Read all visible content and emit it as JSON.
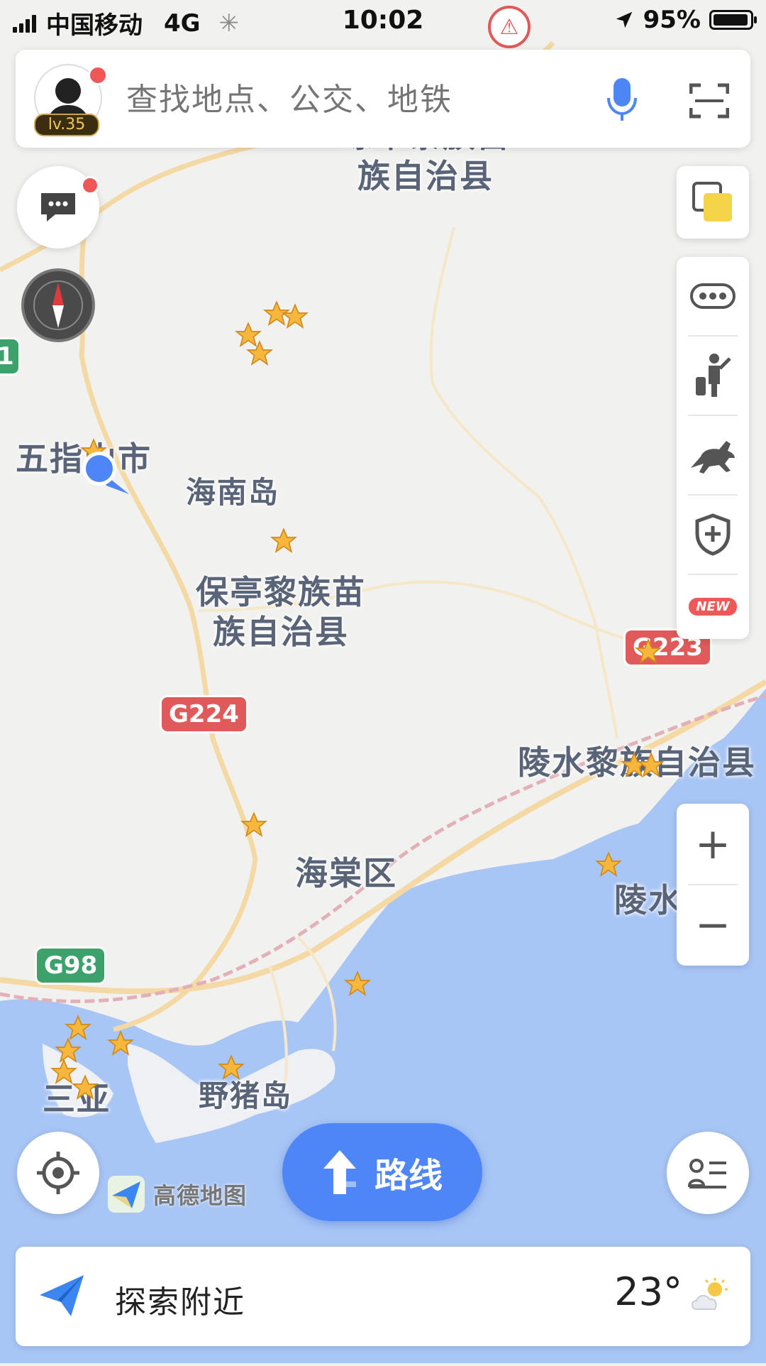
{
  "status_bar": {
    "carrier": "中国移动",
    "network": "4G",
    "time": "10:02",
    "battery": "95%",
    "battery_level": 0.95
  },
  "search": {
    "placeholder": "查找地点、公交、地铁",
    "level": "lv.35",
    "mic_icon": "microphone-icon",
    "scan_icon": "scan-icon"
  },
  "map": {
    "labels": {
      "qiongzhong_top": "琼中黎族苗",
      "qiongzhong_bottom": "族自治县",
      "wuzhishan": "五指山市",
      "hainan_island": "海南岛",
      "baoting_top": "保亭黎族苗",
      "baoting_bottom": "族自治县",
      "lingshui_county": "陵水黎族自治县",
      "haitang": "海棠区",
      "lingshui": "陵水",
      "sanya": "三亚",
      "yezhu_island": "野猪岛"
    },
    "road_shields": {
      "g224": "G224",
      "g223": "G223",
      "g98": "G98",
      "left_edge": "1"
    },
    "colors": {
      "land": "#f1f1ef",
      "sea": "#a7c5f5",
      "road": "#f4d9a4",
      "rail": "#e2b0b6",
      "accent": "#4f86f7"
    }
  },
  "tools": {
    "layers_icon": "layers-icon",
    "more_icon": "more-icon",
    "travel_icon": "traveler-icon",
    "horse_icon": "horse-icon",
    "safety_icon": "shield-plus-icon",
    "new_badge": "NEW"
  },
  "zoom": {
    "in": "+",
    "out": "−"
  },
  "route_button": {
    "label": "路线"
  },
  "logo": {
    "text": "高德地图"
  },
  "bottom_bar": {
    "explore_label": "探索附近",
    "temperature": "23°",
    "weather_icon": "partly-cloudy-icon"
  }
}
